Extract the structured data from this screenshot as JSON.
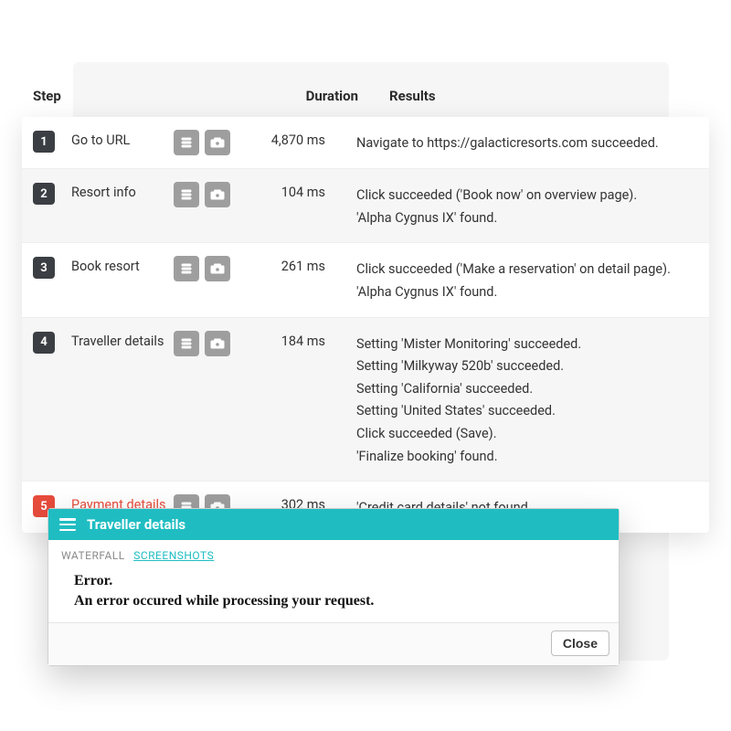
{
  "table": {
    "headers": {
      "step": "Step",
      "duration": "Duration",
      "results": "Results"
    }
  },
  "steps": [
    {
      "num": "1",
      "name": "Go to URL",
      "duration": "4,870 ms",
      "error": false,
      "results": [
        "Navigate to https://galacticresorts.com succeeded."
      ]
    },
    {
      "num": "2",
      "name": "Resort info",
      "duration": "104 ms",
      "error": false,
      "results": [
        "Click succeeded ('Book now' on overview page).",
        "'Alpha Cygnus IX' found."
      ]
    },
    {
      "num": "3",
      "name": "Book resort",
      "duration": "261 ms",
      "error": false,
      "results": [
        "Click succeeded ('Make a reservation' on detail page).",
        "'Alpha Cygnus IX' found."
      ]
    },
    {
      "num": "4",
      "name": "Traveller details",
      "duration": "184 ms",
      "error": false,
      "results": [
        "Setting 'Mister Monitoring' succeeded.",
        "Setting 'Milkyway 520b' succeeded.",
        "Setting 'California' succeeded.",
        "Setting 'United States' succeeded.",
        "Click succeeded (Save).",
        "'Finalize booking' found."
      ]
    },
    {
      "num": "5",
      "name": "Payment details",
      "duration": "302 ms",
      "error": true,
      "results": [
        "'Credit card details' not found."
      ]
    }
  ],
  "dialog": {
    "title": "Traveller details",
    "tabs": {
      "waterfall": "WATERFALL",
      "screenshots": "SCREENSHOTS"
    },
    "error_title": "Error.",
    "error_message": "An error occured while processing your request.",
    "close_label": "Close"
  }
}
